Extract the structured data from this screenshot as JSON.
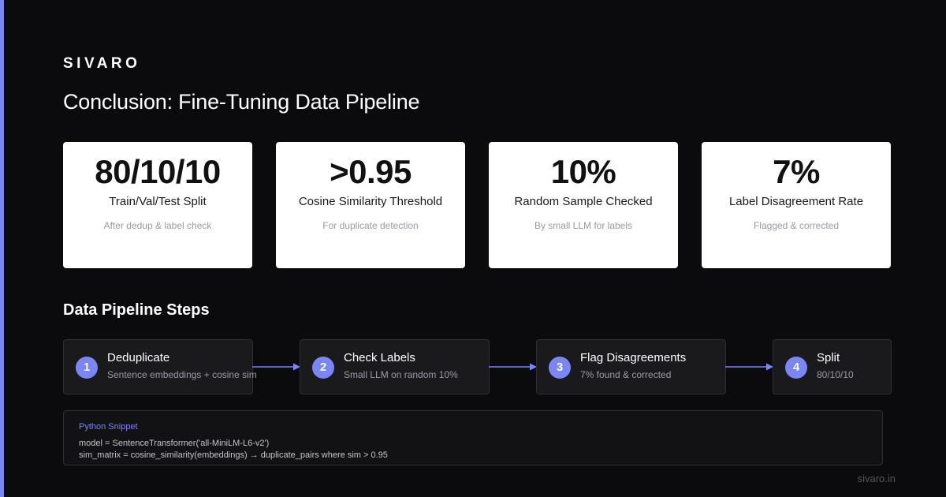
{
  "brand": "SIVARO",
  "title": "Conclusion: Fine-Tuning Data Pipeline",
  "stats": [
    {
      "value": "80/10/10",
      "label": "Train/Val/Test Split",
      "sub": "After dedup & label check"
    },
    {
      "value": ">0.95",
      "label": "Cosine Similarity Threshold",
      "sub": "For duplicate detection"
    },
    {
      "value": "10%",
      "label": "Random Sample Checked",
      "sub": "By small LLM for labels"
    },
    {
      "value": "7%",
      "label": "Label Disagreement Rate",
      "sub": "Flagged & corrected"
    }
  ],
  "section_title": "Data Pipeline Steps",
  "steps": [
    {
      "num": "1",
      "title": "Deduplicate",
      "sub": "Sentence embeddings + cosine sim"
    },
    {
      "num": "2",
      "title": "Check Labels",
      "sub": "Small LLM on random 10%"
    },
    {
      "num": "3",
      "title": "Flag Disagreements",
      "sub": "7% found & corrected"
    },
    {
      "num": "4",
      "title": "Split",
      "sub": "80/10/10"
    }
  ],
  "code": {
    "label": "Python Snippet",
    "lines": [
      "model = SentenceTransformer('all-MiniLM-L6-v2')",
      "sim_matrix = cosine_similarity(embeddings) → duplicate_pairs where sim > 0.95"
    ]
  },
  "footer": "sivaro.in",
  "colors": {
    "background": "#0b0b0d",
    "accent": "#7b86f5",
    "card": "#ffffff",
    "step_bg": "#1a1a1d",
    "muted": "#9a9aa2"
  }
}
